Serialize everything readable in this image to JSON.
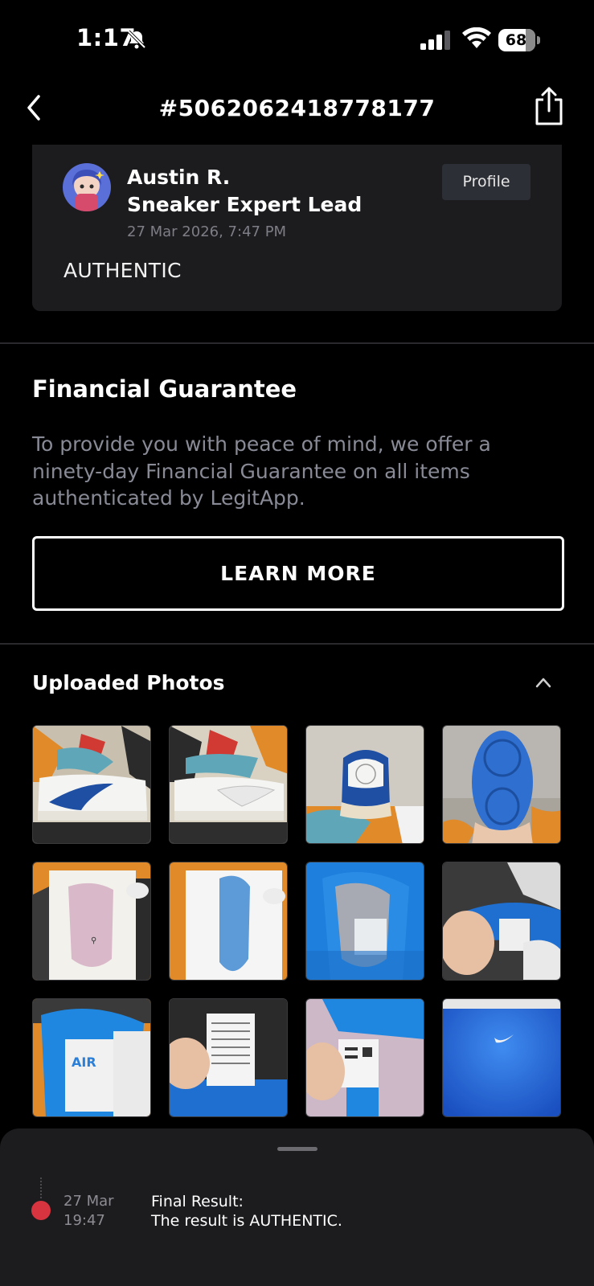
{
  "status_bar": {
    "time": "1:17",
    "battery": "68",
    "bell_icon": "bell-slash-icon"
  },
  "header": {
    "title": "#5062062418778177",
    "back_icon": "chevron-left-icon",
    "share_icon": "share-icon"
  },
  "review": {
    "name": "Austin R.",
    "role": "Sneaker Expert Lead",
    "date": "27 Mar 2026, 7:47 PM",
    "profile_label": "Profile",
    "verdict": "AUTHENTIC"
  },
  "guarantee": {
    "title": "Financial Guarantee",
    "description": "To provide you with peace of mind, we offer a ninety-day Financial Guarantee on all items authenticated by LegitApp.",
    "button_label": "LEARN MORE"
  },
  "photos": {
    "title": "Uploaded Photos",
    "count": 12
  },
  "timeline": {
    "date_line1": "27 Mar",
    "date_line2": "19:47",
    "title_line1": "Final Result:",
    "title_line2": "The result is AUTHENTIC.",
    "dot_color": "#d8343f"
  }
}
